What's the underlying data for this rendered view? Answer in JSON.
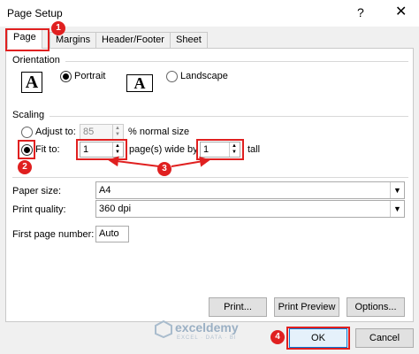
{
  "window": {
    "title": "Page Setup",
    "help": "?",
    "close": "✕"
  },
  "tabs": [
    {
      "label": "Page"
    },
    {
      "label": "Margins"
    },
    {
      "label": "Header/Footer"
    },
    {
      "label": "Sheet"
    }
  ],
  "orientation": {
    "group_label": "Orientation",
    "portrait_label": "Portrait",
    "landscape_label": "Landscape",
    "portrait_icon_glyph": "A",
    "landscape_icon_glyph": "A",
    "selected": "portrait"
  },
  "scaling": {
    "group_label": "Scaling",
    "adjust_label": "Adjust to:",
    "adjust_value": "85",
    "normal_size_label": "% normal size",
    "fit_label": "Fit to:",
    "pages_wide_value": "1",
    "pages_wide_label": "page(s) wide by",
    "tall_value": "1",
    "tall_label": "tall",
    "selected": "fit"
  },
  "paper": {
    "label": "Paper size:",
    "value": "A4"
  },
  "quality": {
    "label": "Print quality:",
    "value": "360 dpi"
  },
  "first_page": {
    "label": "First page number:",
    "value": "Auto"
  },
  "buttons": {
    "print": "Print...",
    "preview": "Print Preview",
    "options": "Options...",
    "ok": "OK",
    "cancel": "Cancel"
  },
  "annotations": {
    "b1": "1",
    "b2": "2",
    "b3": "3",
    "b4": "4"
  },
  "watermark": {
    "name": "exceldemy",
    "tagline": "EXCEL · DATA · BI"
  },
  "colors": {
    "annotation": "#e02020",
    "ok_border": "#0078d7"
  }
}
